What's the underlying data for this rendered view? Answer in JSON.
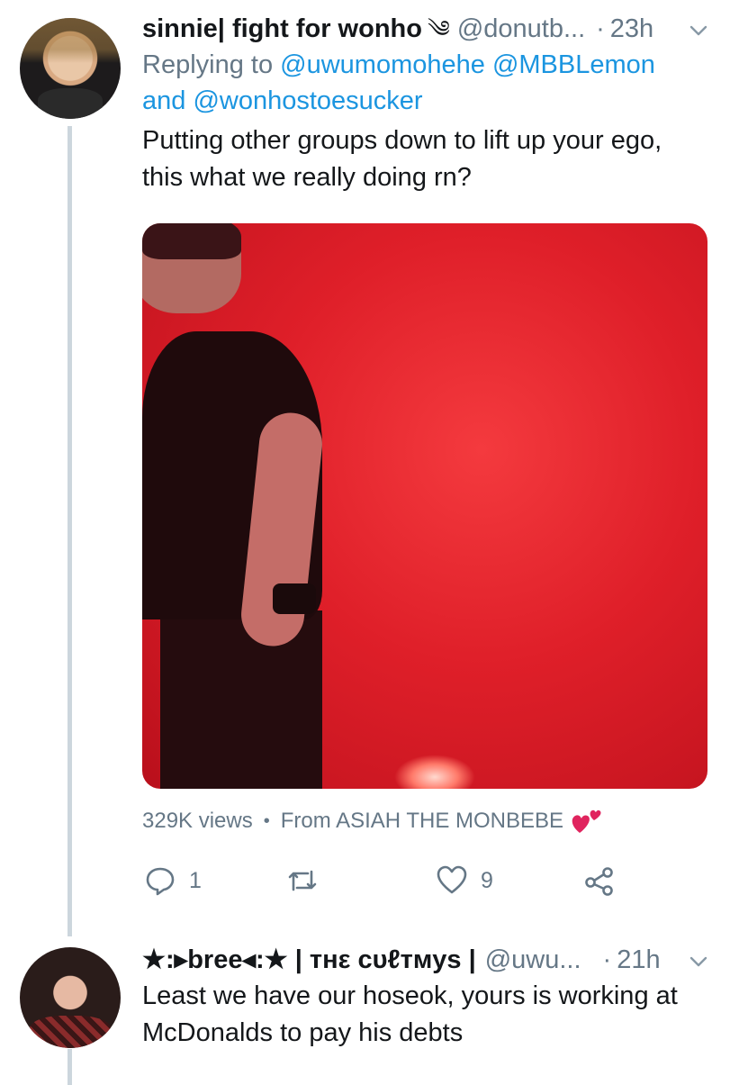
{
  "tweet1": {
    "display_name": "sinnie| fight for wonho",
    "name_icon": "༄",
    "handle": "@donutb...",
    "dot": "·",
    "time": "23h",
    "replying_prefix": "Replying to",
    "mention1": "@uwumomohehe",
    "mention2": "@MBBLemon",
    "and_word": "and",
    "mention3": "@wonhostoesucker",
    "text_line1": "Putting other groups down to lift up your ego,",
    "text_line2": "this what we really doing rn?",
    "views": "329K views",
    "views_sep": "•",
    "source": "From ASIAH THE MONBEBE",
    "reply_count": "1",
    "like_count": "9"
  },
  "tweet2": {
    "display_name": "★:▸bree◂:★ | тнε ᴄᴜℓᴛᴍyѕ |",
    "handle": "@uwu...",
    "dot": "·",
    "time": "21h",
    "text_line1": "Least we have our hoseok, yours is working at",
    "text_line2": "McDonalds to pay his debts"
  },
  "colors": {
    "link": "#1b95e0",
    "muted": "#657786",
    "thread_line": "#ccd6dd"
  }
}
